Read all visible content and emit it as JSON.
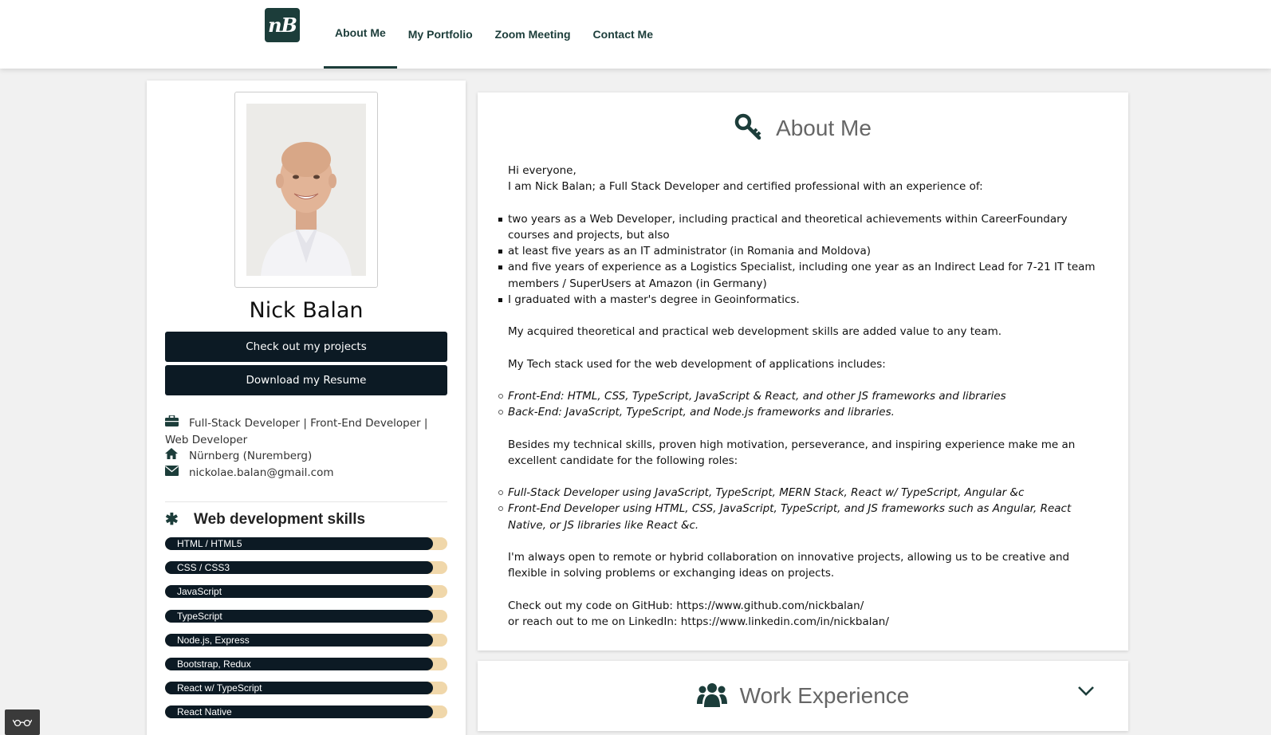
{
  "nav": {
    "logo_text": "nB",
    "items": [
      {
        "label": "About Me",
        "active": true
      },
      {
        "label": "My Portfolio"
      },
      {
        "label": "Zoom Meeting"
      },
      {
        "label": "Contact Me"
      }
    ]
  },
  "profile": {
    "name": "Nick Balan",
    "btn_projects": "Check out my projects",
    "btn_resume": "Download my Resume",
    "role": "Full-Stack Developer | Front-End Developer | Web Developer",
    "location": "Nürnberg (Nuremberg)",
    "email": "nickolae.balan@gmail.com",
    "skills_title": "Web development skills",
    "skills": [
      {
        "label": "HTML / HTML5",
        "level": 0.95
      },
      {
        "label": "CSS / CSS3",
        "level": 0.95
      },
      {
        "label": "JavaScript",
        "level": 0.95
      },
      {
        "label": "TypeScript",
        "level": 0.95
      },
      {
        "label": "Node.js, Express",
        "level": 0.95
      },
      {
        "label": "Bootstrap, Redux",
        "level": 0.95
      },
      {
        "label": "React w/ TypeScript",
        "level": 0.95
      },
      {
        "label": "React Native",
        "level": 0.95
      }
    ]
  },
  "about": {
    "title": "About Me",
    "greeting": "Hi everyone,",
    "intro": "I am Nick Balan; a Full Stack Developer and certified professional with an experience of:",
    "experience": [
      "two years as a Web Developer, including practical and theoretical achievements within CareerFoundary courses and projects, but also",
      "at least five years as an IT administrator (in Romania and Moldova)",
      "and five years of experience as a Logistics Specialist, including one year as an Indirect Lead for 7-21 IT team members / SuperUsers at Amazon (in Germany)",
      "I graduated with a master's degree in Geoinformatics."
    ],
    "value": "My acquired theoretical and practical web development skills are added value to any team.",
    "stack_intro": "My Tech stack used for the web development of applications includes:",
    "stack": [
      "Front-End: HTML, CSS, TypeScript, JavaScript & React, and other JS frameworks and libraries",
      "Back-End: JavaScript, TypeScript, and Node.js frameworks and libraries."
    ],
    "candidate": "Besides my technical skills, proven high motivation, perseverance, and inspiring experience make me an excellent candidate for the following roles:",
    "roles": [
      "Full-Stack Developer using JavaScript, TypeScript, MERN Stack, React w/ TypeScript, Angular &c",
      "Front-End Developer using HTML, CSS, JavaScript, TypeScript, and JS frameworks such as Angular, React Native, or JS libraries like React &c."
    ],
    "collab": "I'm always open to remote or hybrid collaboration on innovative projects, allowing us to be creative and flexible in solving problems or exchanging ideas on projects.",
    "github": "Check out my code on GitHub: https://www.github.com/nickbalan/",
    "linkedin": "or reach out to me on LinkedIn: https://www.linkedin.com/in/nickbalan/"
  },
  "work": {
    "title": "Work Experience"
  },
  "colors": {
    "brand": "#1c3d3a",
    "button": "#0c1a24",
    "skill_track": "#f0d7aa"
  }
}
